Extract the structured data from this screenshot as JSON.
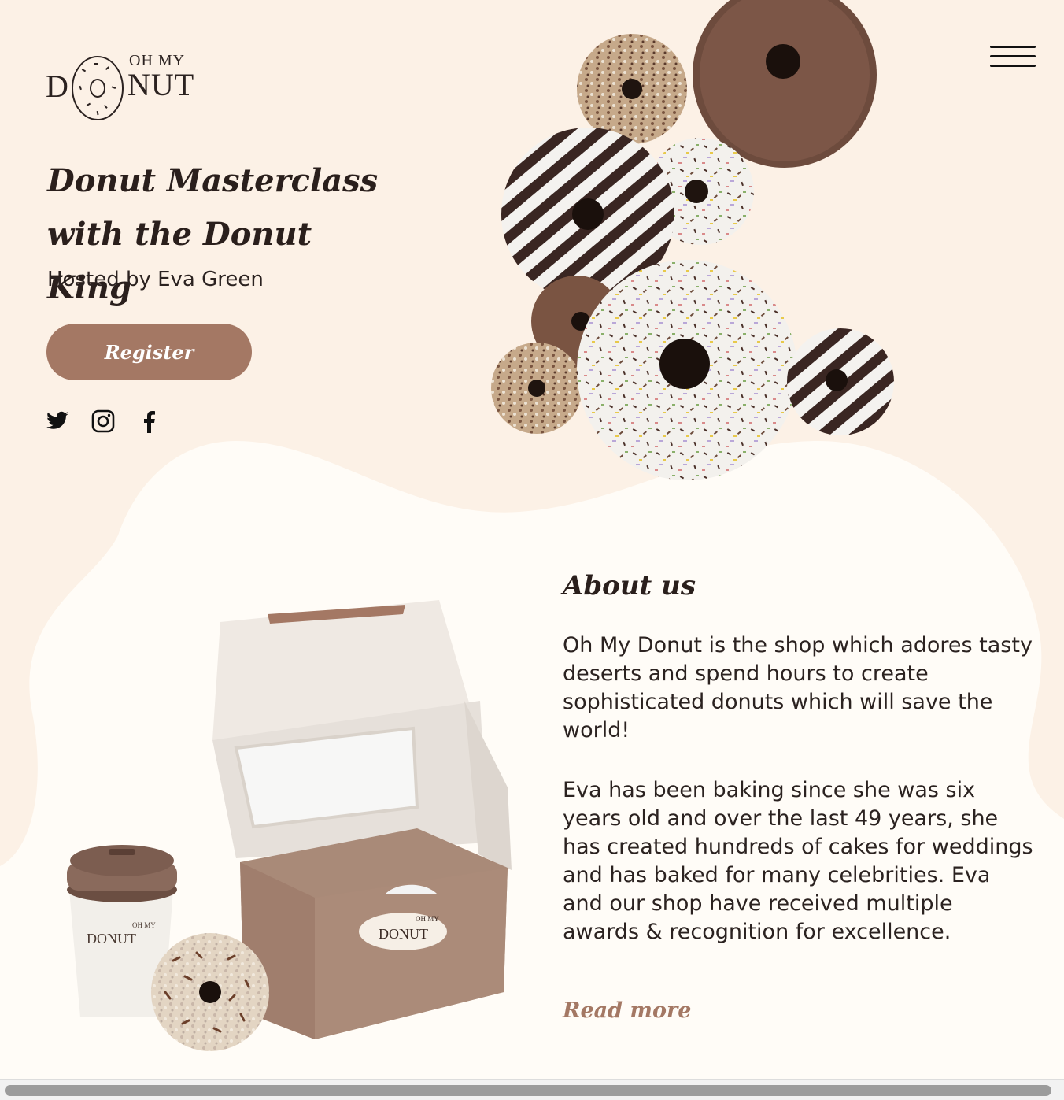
{
  "brand": {
    "logo_top": "OH MY",
    "logo_left": "D",
    "logo_right": "NUT"
  },
  "header": {
    "menu_icon": "hamburger-menu-icon"
  },
  "hero": {
    "title": "Donut Masterclass with the Donut King",
    "host": "Hosted by Eva Green",
    "register_label": "Register",
    "social": [
      "twitter-icon",
      "instagram-icon",
      "facebook-icon"
    ]
  },
  "about": {
    "title": "About us",
    "paragraph_1": "Oh My Donut is the shop which adores tasty deserts and spend hours to create sophisticated donuts which will save the world!",
    "paragraph_2": "Eva has been baking since she was six years old and over the last 49 years, she has created hundreds of cakes for weddings and has baked for many celebrities. Eva and our shop have received multiple awards & recognition for excellence.",
    "read_more": "Read more"
  },
  "product": {
    "cup_logo_top": "OH MY",
    "cup_logo": "DONUT",
    "box_logo_top": "OH MY",
    "box_logo": "DONUT"
  },
  "colors": {
    "background": "#fcf1e6",
    "blob": "#fffcf7",
    "accent": "#a47864",
    "text": "#2b2220"
  }
}
